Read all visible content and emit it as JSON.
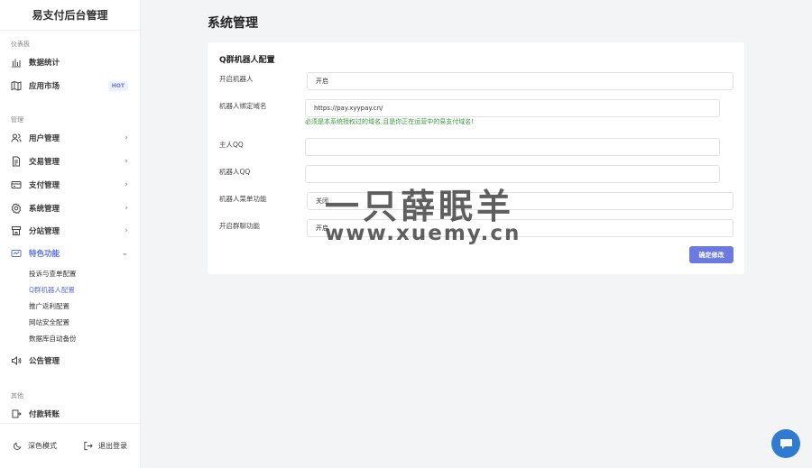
{
  "sidebar": {
    "brand": "易支付后台管理",
    "sections": {
      "dashboard": "仪表板",
      "manage": "管理",
      "other": "其他"
    },
    "items": {
      "stats": "数据统计",
      "market": "应用市场",
      "market_badge": "HOT",
      "users": "用户管理",
      "trade": "交易管理",
      "pay": "支付管理",
      "system": "系统管理",
      "branch": "分站管理",
      "special": "特色功能",
      "notice": "公告管理",
      "transfer": "付款转账"
    },
    "submenu": [
      "投诉与查单配置",
      "Q群机器人配置",
      "推广返利配置",
      "网站安全配置",
      "数据库自动备份"
    ],
    "footer": {
      "dark_mode": "深色模式",
      "logout": "退出登录"
    }
  },
  "main": {
    "title": "系统管理",
    "card_title": "Q群机器人配置",
    "form": {
      "enable_label": "开启机器人",
      "enable_value": "开启",
      "domain_label": "机器人绑定域名",
      "domain_value": "https://pay.xyypay.cn/",
      "domain_hint": "必须是本系统授权过的域名,且是你正在运营中的易支付域名!",
      "owner_label": "主人QQ",
      "owner_value": "",
      "bot_label": "机器人QQ",
      "bot_value": "",
      "menu_label": "机器人菜单功能",
      "menu_value": "关闭",
      "group_label": "开启群聊功能",
      "group_value": "开启"
    },
    "submit": "确定修改"
  },
  "watermark": {
    "title": "一只薛眠羊",
    "url": "www.xuemy.cn"
  },
  "colors": {
    "accent": "#5a6ee6",
    "button": "#6c7ae0",
    "hint": "#3a9a3a",
    "chat": "#2f7bd1"
  }
}
